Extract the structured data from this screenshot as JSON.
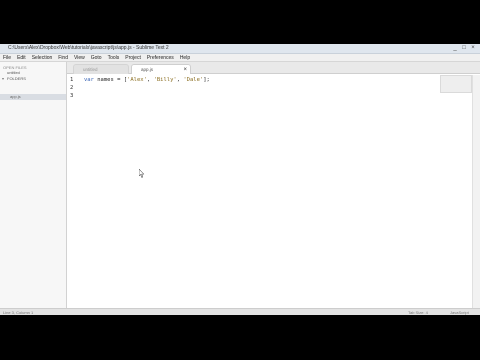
{
  "window": {
    "title": "C:\\Users\\Alex\\Dropbox\\Web\\tutorials\\javascript\\js\\app.js - Sublime Text 2",
    "min_glyph": "_",
    "max_glyph": "□",
    "close_glyph": "×"
  },
  "menu": [
    "File",
    "Edit",
    "Selection",
    "Find",
    "View",
    "Goto",
    "Tools",
    "Project",
    "Preferences",
    "Help"
  ],
  "sidebar": {
    "section_label": "OPEN FILES",
    "open_file": "untitled",
    "folder_label": "FOLDERS",
    "selected_item": "app.js"
  },
  "tabs": [
    {
      "label": "untitled",
      "active": false
    },
    {
      "label": "app.js",
      "active": true,
      "close": "×"
    }
  ],
  "editor": {
    "lines": [
      {
        "number": "1",
        "keyword": "var",
        "rest_before": " names = [",
        "s1": "'Alex'",
        "sep1": ", ",
        "s2": "'Billy'",
        "sep2": ", ",
        "s3": "'Dale'",
        "end": "];"
      },
      {
        "number": "2"
      },
      {
        "number": "3"
      }
    ]
  },
  "status": {
    "left": "Line 3, Column 1",
    "middle": "Tab Size: 4",
    "right": "JavaScript"
  },
  "colors": {
    "keyword": "#3b65b5",
    "string": "#8a6d1f"
  }
}
